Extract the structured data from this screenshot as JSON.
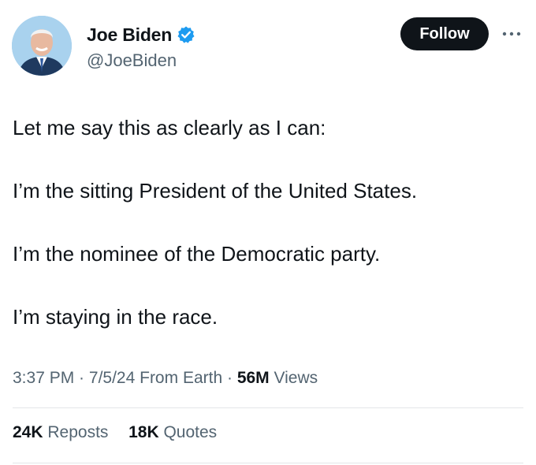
{
  "author": {
    "display_name": "Joe Biden",
    "handle": "@JoeBiden",
    "avatar_icon": "profile-photo",
    "verified_icon": "verified-badge-icon",
    "verified_color": "#1d9bf0"
  },
  "actions": {
    "follow_label": "Follow",
    "more_icon": "more-dots-icon"
  },
  "tweet": {
    "paragraphs": [
      "Let me say this as clearly as I can:",
      "I’m the sitting President of the United States.",
      "I’m the nominee of the Democratic party.",
      "I’m staying in the race."
    ]
  },
  "meta": {
    "time": "3:37 PM",
    "sep1": " · ",
    "date": "7/5/24",
    "source": " From Earth",
    "sep2": " · ",
    "views_count": "56M",
    "views_label": " Views"
  },
  "stats": {
    "reposts_count": "24K",
    "reposts_label": " Reposts",
    "quotes_count": "18K",
    "quotes_label": " Quotes"
  },
  "colors": {
    "text_primary": "#0f1419",
    "text_secondary": "#536471",
    "divider": "#e3e6e8",
    "button_bg": "#0f1419"
  }
}
